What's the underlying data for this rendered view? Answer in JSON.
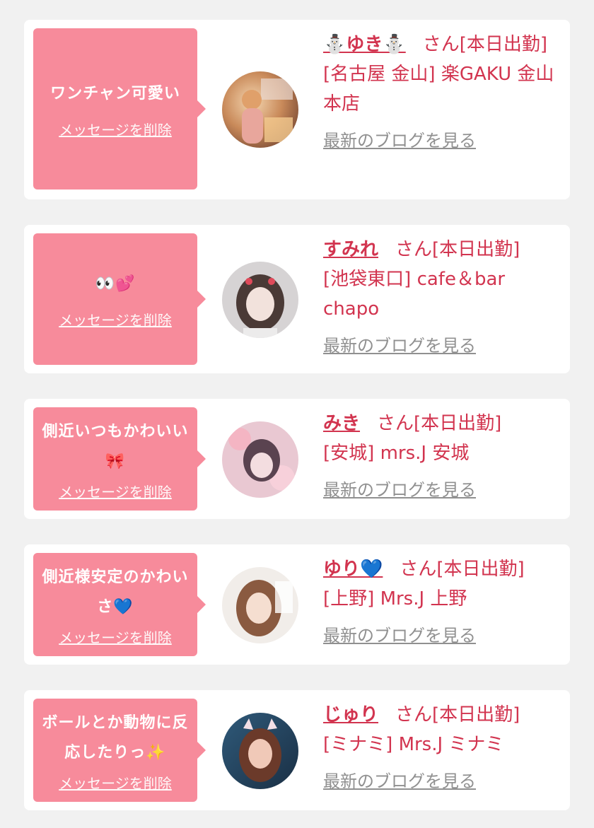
{
  "cards": [
    {
      "message": "ワンチャン可愛い",
      "delete_label": "メッセージを削除",
      "name": "⛄ゆき⛄",
      "status": "さん[本日出勤]",
      "area": "[名古屋 金山]",
      "shop": "楽GAKU 金山本店",
      "blog_label": "最新のブログを見る"
    },
    {
      "message": "👀💕",
      "delete_label": "メッセージを削除",
      "name": "すみれ",
      "status": "さん[本日出勤]",
      "area": "[池袋東口]",
      "shop": "cafe＆bar chapo",
      "blog_label": "最新のブログを見る"
    },
    {
      "message": "側近いつもかわいい🎀",
      "delete_label": "メッセージを削除",
      "name": "みき",
      "status": "さん[本日出勤]",
      "area": "[安城]",
      "shop": "mrs.J 安城",
      "blog_label": "最新のブログを見る"
    },
    {
      "message": "側近様安定のかわいさ💙",
      "delete_label": "メッセージを削除",
      "name": "ゆり💙",
      "status": "さん[本日出勤]",
      "area": "[上野]",
      "shop": "Mrs.J 上野",
      "blog_label": "最新のブログを見る"
    },
    {
      "message": "ボールとか動物に反応したりっ✨",
      "delete_label": "メッセージを削除",
      "name": "じゅり",
      "status": "さん[本日出勤]",
      "area": "[ミナミ]",
      "shop": "Mrs.J ミナミ",
      "blog_label": "最新のブログを見る"
    }
  ],
  "colors": {
    "page_bg": "#f1f1f1",
    "card_bg": "#ffffff",
    "bubble_bg": "#f78b9b",
    "accent_text": "#d2344f",
    "link_gray": "#909090"
  },
  "icons": {
    "avatar": "user-photo-avatar"
  }
}
